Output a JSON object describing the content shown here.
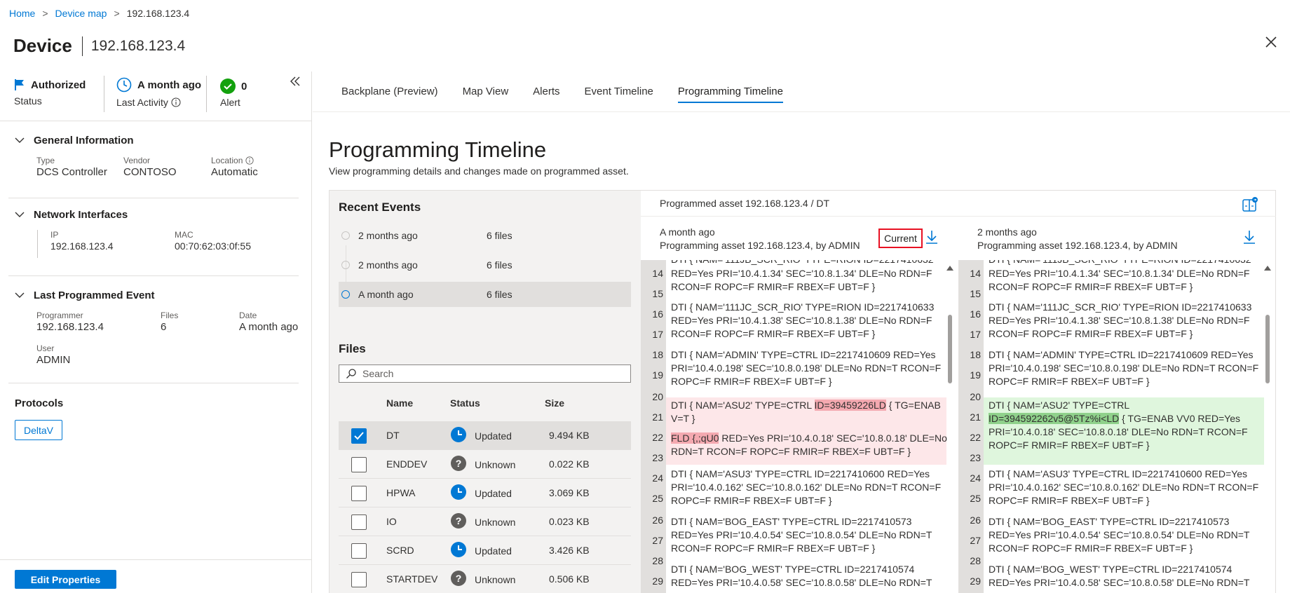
{
  "breadcrumb": {
    "home": "Home",
    "device_map": "Device map",
    "current": "192.168.123.4"
  },
  "header": {
    "title": "Device",
    "ip": "192.168.123.4"
  },
  "summary": {
    "status_value": "Authorized",
    "status_label": "Status",
    "activity_value": "A month ago",
    "activity_label": "Last Activity",
    "alert_value": "0",
    "alert_label": "Alert"
  },
  "general": {
    "title": "General Information",
    "type_label": "Type",
    "type_value": "DCS Controller",
    "vendor_label": "Vendor",
    "vendor_value": "CONTOSO",
    "location_label": "Location",
    "location_value": "Automatic"
  },
  "network": {
    "title": "Network Interfaces",
    "ip_label": "IP",
    "ip_value": "192.168.123.4",
    "mac_label": "MAC",
    "mac_value": "00:70:62:03:0f:55"
  },
  "last_programmed": {
    "title": "Last Programmed Event",
    "programmer_label": "Programmer",
    "programmer_value": "192.168.123.4",
    "files_label": "Files",
    "files_value": "6",
    "date_label": "Date",
    "date_value": "A month ago",
    "user_label": "User",
    "user_value": "ADMIN"
  },
  "protocols": {
    "title": "Protocols",
    "tag": "DeltaV"
  },
  "edit_button": "Edit Properties",
  "tabs": [
    "Backplane (Preview)",
    "Map View",
    "Alerts",
    "Event Timeline",
    "Programming Timeline"
  ],
  "page": {
    "title": "Programming Timeline",
    "subtitle": "View programming details and changes made on programmed asset."
  },
  "recent_events": {
    "title": "Recent Events",
    "items": [
      {
        "time": "2 months ago",
        "files": "6 files"
      },
      {
        "time": "2 months ago",
        "files": "6 files"
      },
      {
        "time": "A month ago",
        "files": "6 files"
      }
    ]
  },
  "files": {
    "title": "Files",
    "search_placeholder": "Search",
    "columns": {
      "name": "Name",
      "status": "Status",
      "size": "Size"
    },
    "rows": [
      {
        "name": "DT",
        "status": "Updated",
        "size": "9.494 KB",
        "checked": true
      },
      {
        "name": "ENDDEV",
        "status": "Unknown",
        "size": "0.022 KB",
        "checked": false
      },
      {
        "name": "HPWA",
        "status": "Updated",
        "size": "3.069 KB",
        "checked": false
      },
      {
        "name": "IO",
        "status": "Unknown",
        "size": "0.023 KB",
        "checked": false
      },
      {
        "name": "SCRD",
        "status": "Updated",
        "size": "3.426 KB",
        "checked": false
      },
      {
        "name": "STARTDEV",
        "status": "Unknown",
        "size": "0.506 KB",
        "checked": false
      }
    ]
  },
  "diff": {
    "header": "Programmed asset 192.168.123.4 / DT",
    "left": {
      "time": "A month ago",
      "by": "Programming asset 192.168.123.4, by ADMIN",
      "badge": "Current"
    },
    "right": {
      "time": "2 months ago",
      "by": "Programming asset 192.168.123.4, by ADMIN"
    },
    "left_blocks": [
      {
        "lines": [
          "14",
          "15"
        ],
        "text": "DTI { NAM='111JB_SCR_RIO' TYPE=RION ID=2217410632\nRED=Yes PRI='10.4.1.34' SEC='10.8.1.34' DLE=No RDN=F\nRCON=F ROPC=F RMIR=F RBEX=F UBT=F }",
        "kind": "normal"
      },
      {
        "lines": [
          "16",
          "17"
        ],
        "text": "DTI { NAM='111JC_SCR_RIO' TYPE=RION ID=2217410633\nRED=Yes PRI='10.4.1.38' SEC='10.8.1.38' DLE=No RDN=F\nRCON=F ROPC=F RMIR=F RBEX=F UBT=F }",
        "kind": "normal"
      },
      {
        "lines": [
          "18",
          "19"
        ],
        "text": "DTI { NAM='ADMIN' TYPE=CTRL ID=2217410609 RED=Yes\nPRI='10.4.0.198' SEC='10.8.0.198' DLE=No RDN=T RCON=F\nROPC=F RMIR=F RBEX=F UBT=F }",
        "kind": "normal"
      },
      {
        "lines": [
          "24",
          "25"
        ],
        "text": "DTI { NAM='ASU3' TYPE=CTRL ID=2217410600 RED=Yes\nPRI='10.4.0.162' SEC='10.8.0.162' DLE=No RDN=T RCON=F\nROPC=F RMIR=F RBEX=F UBT=F }",
        "kind": "normal"
      },
      {
        "lines": [
          "26",
          "27"
        ],
        "text": "DTI { NAM='BOG_EAST' TYPE=CTRL ID=2217410573\nRED=Yes PRI='10.4.0.54' SEC='10.8.0.54' DLE=No RDN=T\nRCON=F ROPC=F RMIR=F RBEX=F UBT=F }",
        "kind": "normal"
      },
      {
        "lines": [
          "28",
          "29"
        ],
        "text": "DTI { NAM='BOG_WEST' TYPE=CTRL ID=2217410574\nRED=Yes PRI='10.4.0.58' SEC='10.8.0.58' DLE=No RDN=T",
        "kind": "normal"
      }
    ],
    "left_changed": {
      "l1_pre": "DTI { NAM='ASU2' TYPE=CTRL ",
      "l1_hl": "ID=39459226LD",
      "l1_post": " { TG=ENAB",
      "l2": "V=T }",
      "l3_hl": "FLD {,;qU0",
      "l3_post": " RED=Yes PRI='10.4.0.18' SEC='10.8.0.18' DLE=No",
      "l4": "RDN=T RCON=F ROPC=F RMIR=F RBEX=F UBT=F }"
    },
    "right_blocks": [
      {
        "lines": [
          "14",
          "15"
        ],
        "text": "DTI { NAM='111JB_SCR_RIO' TYPE=RION ID=2217410632\nRED=Yes PRI='10.4.1.34' SEC='10.8.1.34' DLE=No RDN=F\nRCON=F ROPC=F RMIR=F RBEX=F UBT=F }"
      },
      {
        "lines": [
          "16",
          "17"
        ],
        "text": "DTI { NAM='111JC_SCR_RIO' TYPE=RION ID=2217410633\nRED=Yes PRI='10.4.1.38' SEC='10.8.1.38' DLE=No RDN=F\nRCON=F ROPC=F RMIR=F RBEX=F UBT=F }"
      },
      {
        "lines": [
          "18",
          "19"
        ],
        "text": "DTI { NAM='ADMIN' TYPE=CTRL ID=2217410609 RED=Yes\nPRI='10.4.0.198' SEC='10.8.0.198' DLE=No RDN=T RCON=F\nROPC=F RMIR=F RBEX=F UBT=F }"
      },
      {
        "lines": [
          "24",
          "25"
        ],
        "text": "DTI { NAM='ASU3' TYPE=CTRL ID=2217410600 RED=Yes\nPRI='10.4.0.162' SEC='10.8.0.162' DLE=No RDN=T RCON=F\nROPC=F RMIR=F RBEX=F UBT=F }"
      },
      {
        "lines": [
          "26",
          "27"
        ],
        "text": "DTI { NAM='BOG_EAST' TYPE=CTRL ID=2217410573\nRED=Yes PRI='10.4.0.54' SEC='10.8.0.54' DLE=No RDN=T\nRCON=F ROPC=F RMIR=F RBEX=F UBT=F }"
      },
      {
        "lines": [
          "28",
          "29"
        ],
        "text": "DTI { NAM='BOG_WEST' TYPE=CTRL ID=2217410574\nRED=Yes PRI='10.4.0.58' SEC='10.8.0.58' DLE=No RDN=T"
      }
    ],
    "right_changed": {
      "l1": "DTI { NAM='ASU2' TYPE=CTRL",
      "l2_hl": "ID=394592262v5@5Tz%i<LD",
      "l2_post": " { TG=ENAB VV0 RED=Yes",
      "l3": "PRI='10.4.0.18' SEC='10.8.0.18' DLE=No RDN=T RCON=F",
      "l4": "ROPC=F RMIR=F RBEX=F UBT=F }"
    },
    "left_changed_lines": [
      "20",
      "21",
      "22",
      "23"
    ],
    "right_changed_lines": [
      "20",
      "21",
      "22",
      "23"
    ]
  },
  "colors": {
    "accent": "#0078d4",
    "added": "#dff6dd",
    "removed": "#fde7e9",
    "success": "#13a10e"
  }
}
